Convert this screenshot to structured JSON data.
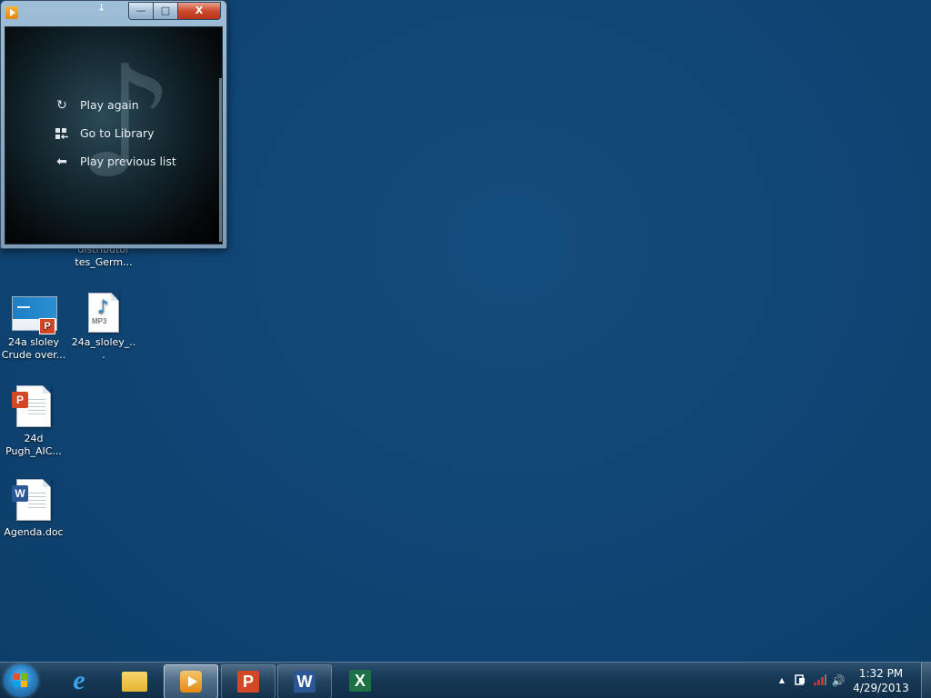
{
  "desktop": {
    "background_color": "#0f4473",
    "partial_icon": {
      "label_line1": "distributor",
      "label_line2": "tes_Germ..."
    },
    "icons": [
      {
        "label": "24a sloley Crude over...",
        "icon": "powerpoint-slide-icon"
      },
      {
        "label": "24a_sloley_...",
        "icon": "mp3-file-icon",
        "badge_text": "MP3"
      },
      {
        "label": "24d Pugh_AIC...",
        "icon": "powerpoint-document-icon",
        "badge_text": "P"
      },
      {
        "label": "Agenda.doc",
        "icon": "word-document-icon",
        "badge_text": "W"
      }
    ]
  },
  "media_player": {
    "title": "",
    "caption_buttons": {
      "minimize": "—",
      "maximize": "□",
      "close": "X"
    },
    "menu": [
      {
        "label": "Play again",
        "icon": "replay-icon"
      },
      {
        "label": "Go to Library",
        "icon": "library-icon"
      },
      {
        "label": "Play previous list",
        "icon": "back-arrow-icon"
      }
    ]
  },
  "taskbar": {
    "buttons": [
      {
        "name": "internet-explorer",
        "icon": "internet-explorer-icon",
        "glyph": "e"
      },
      {
        "name": "windows-explorer",
        "icon": "folder-icon",
        "glyph": ""
      },
      {
        "name": "windows-media-player",
        "icon": "media-player-icon",
        "glyph": ""
      },
      {
        "name": "powerpoint",
        "icon": "powerpoint-icon",
        "glyph": "P"
      },
      {
        "name": "word",
        "icon": "word-icon",
        "glyph": "W"
      },
      {
        "name": "excel",
        "icon": "excel-icon",
        "glyph": "X"
      }
    ],
    "tray": {
      "overflow": "▲",
      "time": "1:32 PM",
      "date": "4/29/2013"
    }
  }
}
